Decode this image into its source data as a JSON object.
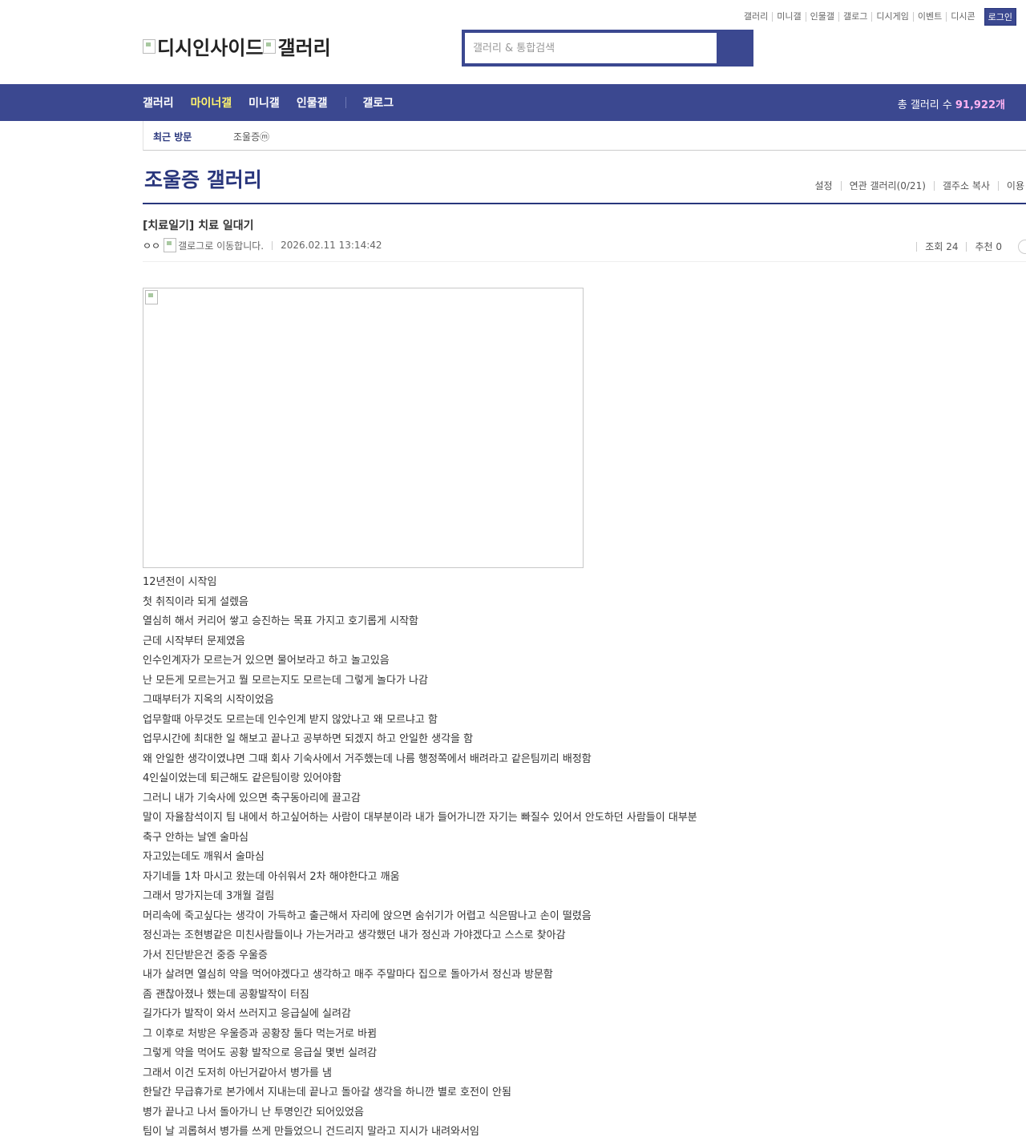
{
  "top_links": [
    "갤러리",
    "미니갤",
    "인물갤",
    "갤로그",
    "디시게임",
    "이벤트",
    "디시콘"
  ],
  "login_label": "로그인",
  "logo": {
    "part1": "디시인사이드",
    "part2": "갤러리"
  },
  "search": {
    "placeholder": "갤러리 & 통합검색"
  },
  "nav": {
    "items": [
      "갤러리",
      "마이너갤",
      "미니갤",
      "인물갤",
      "갤로그"
    ],
    "active": "마이너갤",
    "total_label": "총 갤러리 수",
    "total_count": "91,922개"
  },
  "recent": {
    "label": "최근 방문",
    "items": [
      "조울증ⓜ"
    ]
  },
  "gallery": {
    "title": "조울증 갤러리",
    "menu": [
      "설정",
      "연관 갤러리(0/21)",
      "갤주소 복사",
      "이용"
    ]
  },
  "post": {
    "title": "[치료일기] 치료 일대기",
    "author": "ㅇㅇ",
    "gallog_alt": "갤로그로 이동합니다.",
    "date": "2026.02.11 13:14:42",
    "views": "조회 24",
    "recommend": "추천 0",
    "lines": [
      "12년전이 시작임",
      "첫 취직이라 되게 설렜음",
      "열심히 해서 커리어 쌓고 승진하는 목표 가지고 호기롭게 시작함",
      "근데 시작부터 문제였음",
      "인수인계자가 모르는거 있으면 물어보라고 하고 놀고있음",
      "난 모든게 모르는거고 뭘 모르는지도 모르는데 그렇게 놀다가 나감",
      "그때부터가 지옥의 시작이었음",
      "업무할때 아무것도 모르는데 인수인계 받지 않았나고 왜 모르냐고 함",
      "업무시간에 최대한 일 해보고 끝나고 공부하면 되겠지 하고 안일한 생각을 함",
      "왜 안일한 생각이였냐면 그때 회사 기숙사에서 거주했는데 나름 행정쪽에서 배려라고 같은팀끼리 배정함",
      "4인실이었는데 퇴근해도 같은팀이랑 있어야함",
      "그러니 내가 기숙사에 있으면 축구동아리에 끌고감",
      "말이 자율참석이지 팀 내에서 하고싶어하는 사람이 대부분이라 내가 들어가니깐 자기는 빠질수 있어서 안도하던 사람들이 대부분",
      "축구 안하는 날엔 술마심",
      "자고있는데도 깨워서 술마심",
      "자기네들 1차 마시고 왔는데 아쉬워서 2차 해야한다고 깨움",
      "그래서 망가지는데 3개월 걸림",
      "머리속에 죽고싶다는 생각이 가득하고 출근해서 자리에 앉으면 숨쉬기가 어렵고 식은땀나고 손이 떨렸음",
      "정신과는 조현병같은 미친사람들이나 가는거라고 생각했던 내가 정신과 가야겠다고 스스로 찾아감",
      "가서 진단받은건 중증 우울증",
      "내가 살려면 열심히 약을 먹어야겠다고 생각하고 매주 주말마다 집으로 돌아가서 정신과 방문함",
      "좀 괜찮아졌나 했는데 공황발작이 터짐",
      "길가다가 발작이 와서 쓰러지고 응급실에 실려감",
      "그 이후로 처방은 우울증과 공황장 둘다 먹는거로 바뀜",
      "그렇게 약을 먹어도 공황 발작으로 응급실 몇번 실려감",
      "그래서 이건 도저히 아닌거같아서 병가를 냄",
      "한달간 무급휴가로 본가에서 지내는데 끝나고 돌아갈 생각을 하니깐 별로 호전이 안됨",
      "병가 끝나고 나서 돌아가니 난 투명인간 되어있었음",
      "팀이 날 괴롭혀서 병가를 쓰게 만들었으니 건드리지 말라고 지시가 내려와서임"
    ]
  },
  "colors": {
    "brand": "#3b4890",
    "brand_dark": "#29367c",
    "active_nav": "#fff36d",
    "count": "#ffb3f3"
  }
}
